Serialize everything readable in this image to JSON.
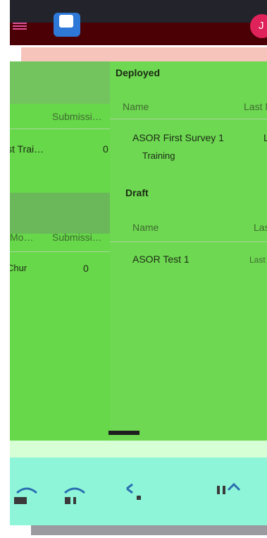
{
  "app": {
    "avatar_initial": "J"
  },
  "deployed_panel": {
    "heading": "Deployed",
    "column_name": "Name",
    "column_last": "Last M",
    "surveys": [
      {
        "name": "ASOR First Survey 1",
        "sub": "Training",
        "last": "L"
      }
    ]
  },
  "draft_panel": {
    "heading": "Draft",
    "column_name": "Name",
    "column_last": "Las",
    "surveys": [
      {
        "name": "ASOR Test 1",
        "last": "Last"
      }
    ]
  },
  "left_column": {
    "top_block": {
      "header_submissions": "Submissi…",
      "row_name": "st Trai…",
      "row_value": "0"
    },
    "bottom_block": {
      "header_modified": "Mo…",
      "header_submissions": "Submissi…",
      "row_name": "Chur",
      "row_value": "0"
    }
  },
  "colors": {
    "appbar": "#4a0004",
    "left_panel": "#67d84a",
    "right_panel": "#6ed852",
    "bottom_nav": "#8ff5d9",
    "accent_logo": "#2e78d8",
    "avatar": "#e0225a"
  },
  "bottom_nav": {
    "items": [
      {
        "icon": "forms-icon"
      },
      {
        "icon": "submissions-icon"
      },
      {
        "icon": "add-icon"
      },
      {
        "icon": "reports-icon"
      },
      {
        "icon": "settings-icon"
      }
    ]
  }
}
